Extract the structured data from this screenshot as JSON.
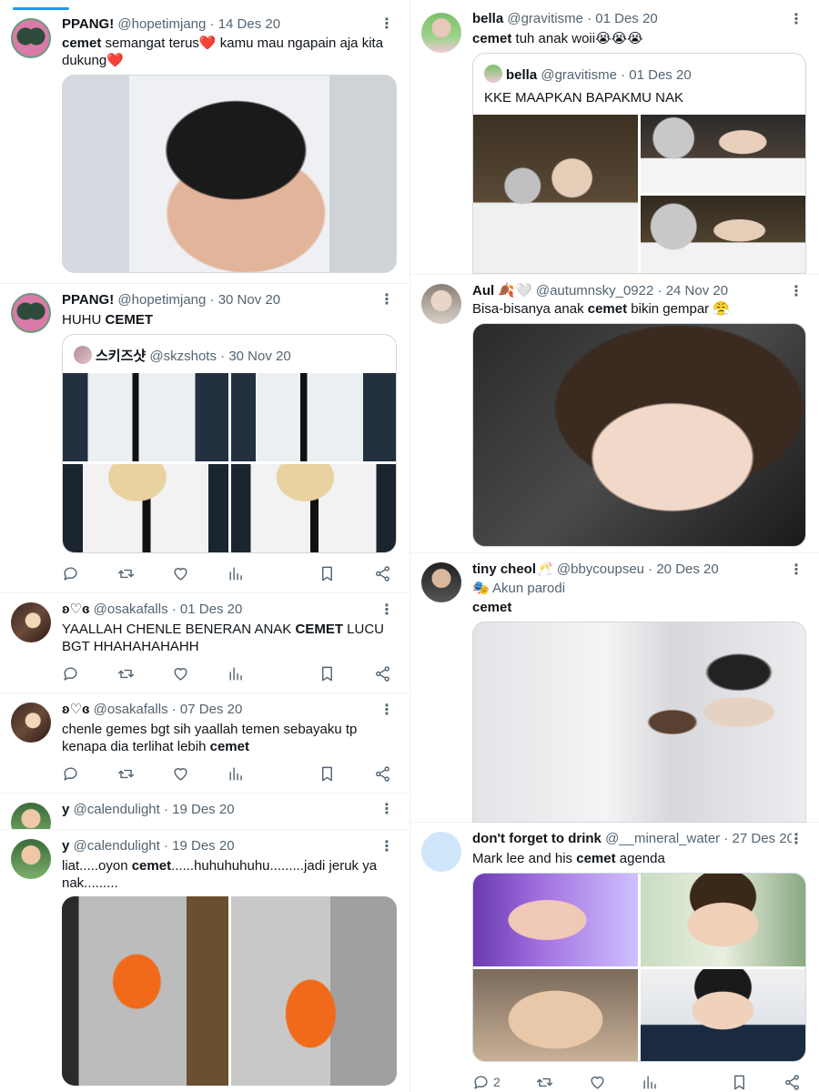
{
  "left_tweets": [
    {
      "name": "PPANG!",
      "handle": "@hopetimjang",
      "date": "14 Des 20",
      "text_parts": [
        "cemet",
        " semangat terus❤️ kamu mau ngapain aja kita dukung❤️"
      ]
    },
    {
      "name": "PPANG!",
      "handle": "@hopetimjang",
      "date": "30 Nov 20",
      "text_parts": [
        "HUHU ",
        "CEMET"
      ],
      "quote": {
        "name": "스키즈샷",
        "handle": "@skzshots",
        "date": "30 Nov 20"
      }
    },
    {
      "name": "ʚ♡ɞ",
      "handle": "@osakafalls",
      "date": "01 Des 20",
      "text_parts": [
        "YAALLAH CHENLE BENERAN ANAK ",
        "CEMET",
        " LUCU BGT HHAHAHAHAHH"
      ]
    },
    {
      "name": "ʚ♡ɞ",
      "handle": "@osakafalls",
      "date": "07 Des 20",
      "text_parts": [
        "chenle gemes bgt sih yaallah temen sebayaku tp kenapa dia terlihat lebih ",
        "cemet"
      ]
    },
    {
      "name": "y",
      "handle": "@calendulight",
      "date": "19 Des 20"
    },
    {
      "name": "y",
      "handle": "@calendulight",
      "date": "19 Des 20",
      "text_parts": [
        "liat.....oyon ",
        "cemet",
        "......huhuhuhuhu.........jadi jeruk ya nak........."
      ]
    }
  ],
  "right_tweets": [
    {
      "name": "bella",
      "handle": "@gravitisme",
      "date": "01 Des 20",
      "text_parts": [
        "cemet",
        " tuh anak woii😭😭😭"
      ],
      "quote": {
        "name": "bella",
        "handle": "@gravitisme",
        "date": "01 Des 20",
        "text": "KKE MAAPKAN BAPAKMU NAK"
      }
    },
    {
      "name": "Aul 🍂🤍",
      "handle": "@autumnsky_0922",
      "date": "24 Nov 20",
      "text_parts": [
        "Bisa-bisanya anak ",
        "cemet",
        " bikin gempar 😤"
      ]
    },
    {
      "name": "tiny cheol🥂",
      "handle": "@bbycoupseu",
      "date": "20 Des 20",
      "parody": "🎭 Akun parodi",
      "text_parts": [
        "cemet"
      ]
    },
    {
      "name": "don't forget to drink",
      "handle": "@__mineral_water",
      "date": "27 Des 20",
      "text_parts": [
        "Mark lee and his ",
        "cemet",
        " agenda"
      ],
      "reply_count": "2"
    }
  ],
  "icons": {
    "more": "more-options-icon",
    "reply": "reply-icon",
    "retweet": "retweet-icon",
    "like": "like-icon",
    "views": "views-icon",
    "bookmark": "bookmark-icon",
    "share": "share-icon"
  },
  "colors": {
    "accent": "#1d9bf0",
    "secondary_text": "#536471",
    "border": "#eff3f4"
  },
  "separator": "·"
}
